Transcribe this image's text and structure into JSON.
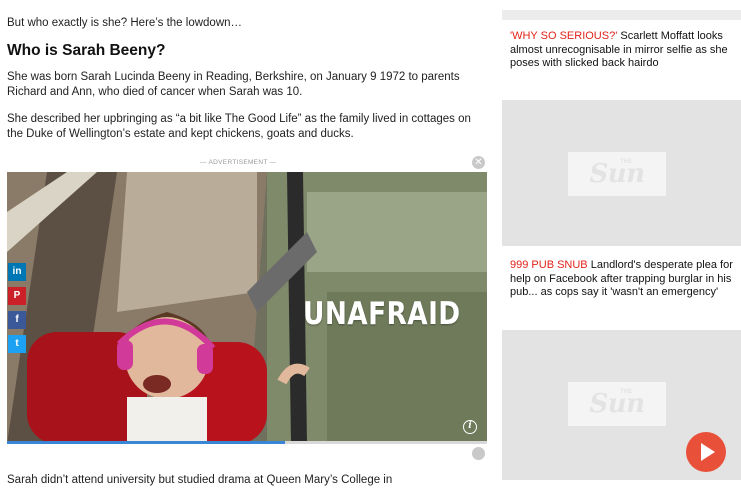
{
  "article": {
    "lead": "But who exactly is she? Here’s the lowdown…",
    "heading": "Who is Sarah Beeny?",
    "para1": "She was born Sarah Lucinda Beeny in Reading, Berkshire, on January 9 1972 to parents Richard and Ann, who died of cancer when Sarah was 10.",
    "para2": "She described her upbringing as “a bit like The Good Life” as the family lived in cottages on the Duke of Wellington’s estate and kept chickens, goats and ducks.",
    "bottom": "Sarah didn’t attend university but studied drama at Queen Mary’s College in"
  },
  "ad": {
    "label": "— ADVERTISEMENT —",
    "close": "✕",
    "overlay_text": "UNAFRAID",
    "info": "i",
    "progress_fraction": 0.58
  },
  "share": {
    "linkedin": "in",
    "pinterest": "P",
    "facebook": "f",
    "twitter": "t"
  },
  "sidebar": {
    "story1_kicker": "'WHY SO SERIOUS?'",
    "story1_text": " Scarlett Moffatt looks almost unrecognisable in mirror selfie as she poses with slicked back hairdo",
    "story2_kicker": "999 PUB SNUB",
    "story2_text": " Landlord's desperate plea for help on Facebook after trapping burglar in his pub... as cops say it 'wasn't an emergency'",
    "logo_text": "Sun",
    "logo_small": "THE"
  },
  "colors": {
    "accent_red": "#e2231a",
    "play_orange": "#e8503a",
    "progress_blue": "#3a86d6"
  }
}
